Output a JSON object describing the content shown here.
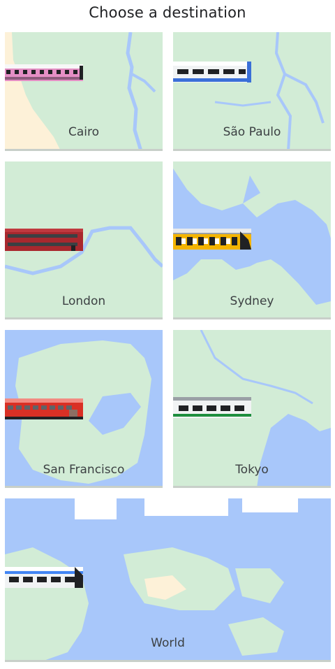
{
  "title": "Choose a destination",
  "cities": [
    {
      "name": "Cairo"
    },
    {
      "name": "São Paulo"
    },
    {
      "name": "London"
    },
    {
      "name": "Sydney"
    },
    {
      "name": "San Francisco"
    },
    {
      "name": "Tokyo"
    }
  ],
  "world": {
    "name": "World"
  },
  "colors": {
    "land": "#d2ecd6",
    "land_alt": "#dff3e2",
    "water": "#a8c7fa",
    "water_alt": "#c0d6fb",
    "sand": "#fdf1d8",
    "train_cairo": "#e58fc5",
    "train_saopaulo": "#3a6fd8",
    "train_london": "#a9282e",
    "train_sydney": "#f4b400",
    "train_sf": "#d93025",
    "train_tokyo": "#1e8e3e",
    "train_world": "#4285f4"
  }
}
